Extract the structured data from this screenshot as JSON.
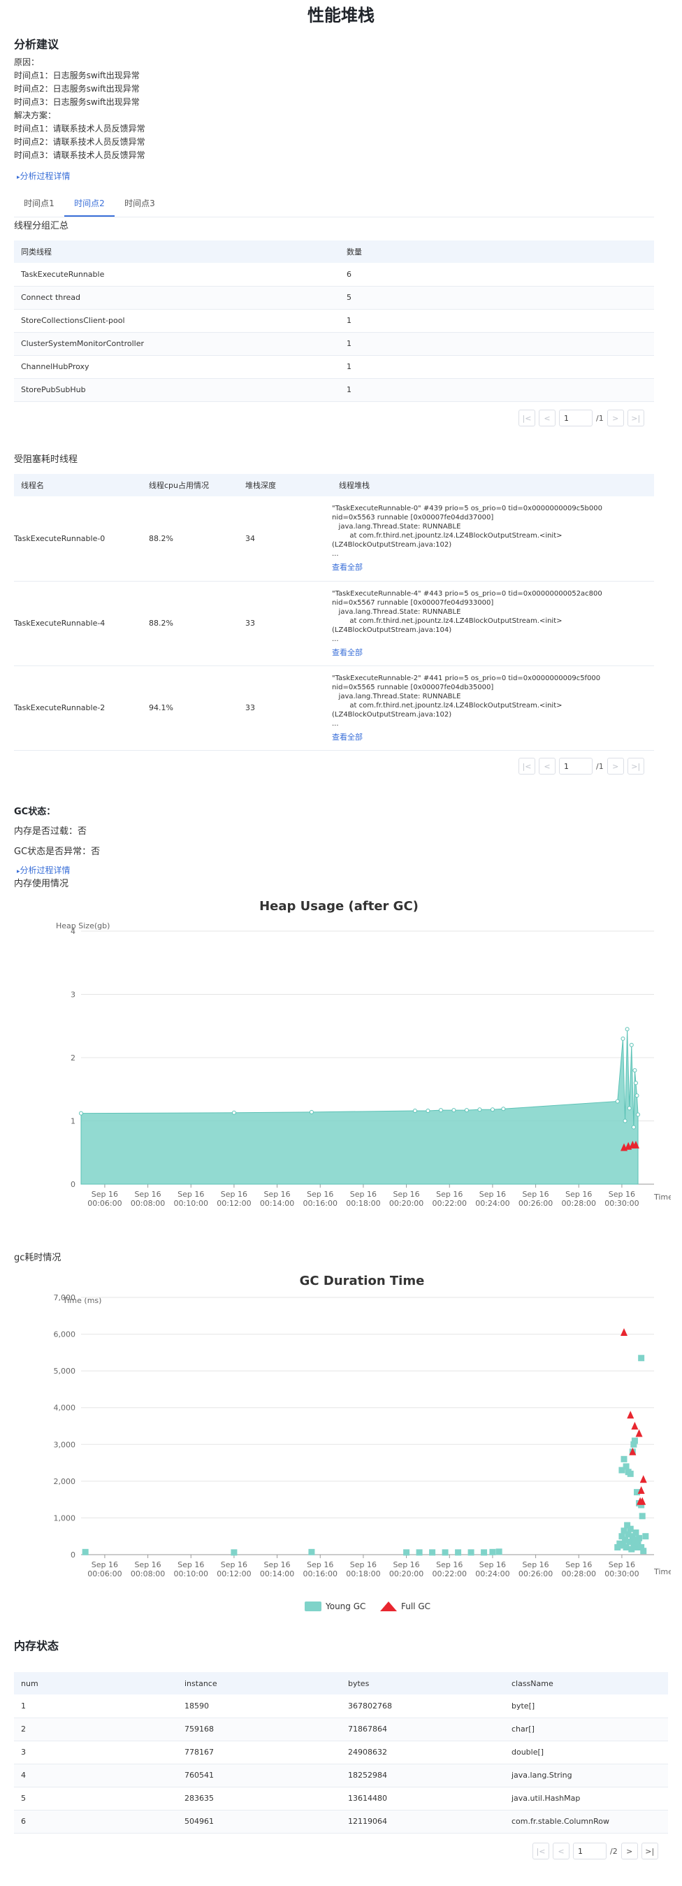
{
  "page": {
    "title": "性能堆栈"
  },
  "analysis": {
    "title": "分析建议",
    "reason_label": "原因：",
    "reasons": [
      "时间点1：日志服务swift出现异常",
      "时间点2：日志服务swift出现异常",
      "时间点3：日志服务swift出现异常"
    ],
    "solution_label": "解决方案：",
    "solutions": [
      "时间点1：请联系技术人员反馈异常",
      "时间点2：请联系技术人员反馈异常",
      "时间点3：请联系技术人员反馈异常"
    ],
    "detail_link": "分析过程详情"
  },
  "tabs": [
    {
      "label": "时间点1",
      "active": false
    },
    {
      "label": "时间点2",
      "active": true
    },
    {
      "label": "时间点3",
      "active": false
    }
  ],
  "thread_group": {
    "title": "线程分组汇总",
    "columns": [
      "同类线程",
      "数量"
    ],
    "rows": [
      [
        "TaskExecuteRunnable",
        "6"
      ],
      [
        "Connect thread",
        "5"
      ],
      [
        "StoreCollectionsClient-pool",
        "1"
      ],
      [
        "ClusterSystemMonitorController",
        "1"
      ],
      [
        "ChannelHubProxy",
        "1"
      ],
      [
        "StorePubSubHub",
        "1"
      ]
    ],
    "pagination": {
      "page": "1",
      "total": "/1"
    }
  },
  "blocked_threads": {
    "title": "受阻塞耗时线程",
    "columns": [
      "线程名",
      "线程cpu占用情况",
      "堆栈深度",
      "线程堆栈"
    ],
    "view_all": "查看全部",
    "rows": [
      {
        "name": "TaskExecuteRunnable-0",
        "cpu": "88.2%",
        "depth": "34",
        "stack": "\"TaskExecuteRunnable-0\" #439 prio=5 os_prio=0 tid=0x0000000009c5b000\nnid=0x5563 runnable [0x00007fe04dd37000]\n   java.lang.Thread.State: RUNNABLE\n        at com.fr.third.net.jpountz.lz4.LZ4BlockOutputStream.<init>\n(LZ4BlockOutputStream.java:102)\n..."
      },
      {
        "name": "TaskExecuteRunnable-4",
        "cpu": "88.2%",
        "depth": "33",
        "stack": "\"TaskExecuteRunnable-4\" #443 prio=5 os_prio=0 tid=0x00000000052ac800\nnid=0x5567 runnable [0x00007fe04d933000]\n   java.lang.Thread.State: RUNNABLE\n        at com.fr.third.net.jpountz.lz4.LZ4BlockOutputStream.<init>\n(LZ4BlockOutputStream.java:104)\n..."
      },
      {
        "name": "TaskExecuteRunnable-2",
        "cpu": "94.1%",
        "depth": "33",
        "stack": "\"TaskExecuteRunnable-2\" #441 prio=5 os_prio=0 tid=0x0000000009c5f000\nnid=0x5565 runnable [0x00007fe04db35000]\n   java.lang.Thread.State: RUNNABLE\n        at com.fr.third.net.jpountz.lz4.LZ4BlockOutputStream.<init>\n(LZ4BlockOutputStream.java:102)\n..."
      }
    ],
    "pagination": {
      "page": "1",
      "total": "/1"
    }
  },
  "gc": {
    "title": "GC状态：",
    "overload": "内存是否过载：否",
    "abnormal": "GC状态是否异常：否",
    "detail_link": "分析过程详情",
    "memory_usage_label": "内存使用情况",
    "gc_time_label": "gc耗时情况"
  },
  "chart_data": [
    {
      "type": "area",
      "title": "Heap Usage (after GC)",
      "ylabel": "Heap Size(gb)",
      "xlabel": "Time",
      "ylim": [
        0,
        4
      ],
      "yticks": [
        "0",
        "1",
        "2",
        "3",
        "4"
      ],
      "xticks": [
        {
          "t": 6,
          "l1": "Sep 16",
          "l2": "00:06:00"
        },
        {
          "t": 8,
          "l1": "Sep 16",
          "l2": "00:08:00"
        },
        {
          "t": 10,
          "l1": "Sep 16",
          "l2": "00:10:00"
        },
        {
          "t": 12,
          "l1": "Sep 16",
          "l2": "00:12:00"
        },
        {
          "t": 14,
          "l1": "Sep 16",
          "l2": "00:14:00"
        },
        {
          "t": 16,
          "l1": "Sep 16",
          "l2": "00:16:00"
        },
        {
          "t": 18,
          "l1": "Sep 16",
          "l2": "00:18:00"
        },
        {
          "t": 20,
          "l1": "Sep 16",
          "l2": "00:20:00"
        },
        {
          "t": 22,
          "l1": "Sep 16",
          "l2": "00:22:00"
        },
        {
          "t": 24,
          "l1": "Sep 16",
          "l2": "00:24:00"
        },
        {
          "t": 26,
          "l1": "Sep 16",
          "l2": "00:26:00"
        },
        {
          "t": 28,
          "l1": "Sep 16",
          "l2": "00:28:00"
        },
        {
          "t": 30,
          "l1": "Sep 16",
          "l2": "00:30:00"
        }
      ],
      "series": [
        {
          "color": "#7fd3c9",
          "points": [
            [
              4.9,
              1.12
            ],
            [
              12.0,
              1.13
            ],
            [
              15.6,
              1.14
            ],
            [
              20.4,
              1.16
            ],
            [
              21.0,
              1.16
            ],
            [
              21.6,
              1.17
            ],
            [
              22.2,
              1.17
            ],
            [
              22.8,
              1.17
            ],
            [
              23.4,
              1.18
            ],
            [
              24.0,
              1.18
            ],
            [
              24.5,
              1.19
            ],
            [
              29.8,
              1.31
            ],
            [
              30.05,
              2.3
            ],
            [
              30.15,
              1.0
            ],
            [
              30.25,
              2.45
            ],
            [
              30.35,
              1.2
            ],
            [
              30.45,
              2.2
            ],
            [
              30.55,
              0.9
            ],
            [
              30.6,
              1.8
            ],
            [
              30.65,
              1.6
            ],
            [
              30.7,
              1.4
            ],
            [
              30.75,
              1.1
            ]
          ]
        },
        {
          "color": "#e8262f",
          "marker": "triangle",
          "points": [
            [
              30.1,
              0.58
            ],
            [
              30.3,
              0.6
            ],
            [
              30.5,
              0.62
            ],
            [
              30.65,
              0.62
            ]
          ]
        }
      ]
    },
    {
      "type": "scatter",
      "title": "GC Duration Time",
      "ylabel": "Time (ms)",
      "xlabel": "Time",
      "ylim": [
        0,
        7000
      ],
      "yticks": [
        "0",
        "1,000",
        "2,000",
        "3,000",
        "4,000",
        "5,000",
        "6,000",
        "7,000"
      ],
      "xticks": [
        {
          "t": 6,
          "l1": "Sep 16",
          "l2": "00:06:00"
        },
        {
          "t": 8,
          "l1": "Sep 16",
          "l2": "00:08:00"
        },
        {
          "t": 10,
          "l1": "Sep 16",
          "l2": "00:10:00"
        },
        {
          "t": 12,
          "l1": "Sep 16",
          "l2": "00:12:00"
        },
        {
          "t": 14,
          "l1": "Sep 16",
          "l2": "00:14:00"
        },
        {
          "t": 16,
          "l1": "Sep 16",
          "l2": "00:16:00"
        },
        {
          "t": 18,
          "l1": "Sep 16",
          "l2": "00:18:00"
        },
        {
          "t": 20,
          "l1": "Sep 16",
          "l2": "00:20:00"
        },
        {
          "t": 22,
          "l1": "Sep 16",
          "l2": "00:22:00"
        },
        {
          "t": 24,
          "l1": "Sep 16",
          "l2": "00:24:00"
        },
        {
          "t": 26,
          "l1": "Sep 16",
          "l2": "00:26:00"
        },
        {
          "t": 28,
          "l1": "Sep 16",
          "l2": "00:28:00"
        },
        {
          "t": 30,
          "l1": "Sep 16",
          "l2": "00:30:00"
        }
      ],
      "legend": [
        "Young GC",
        "Full GC"
      ],
      "series": [
        {
          "name": "Young GC",
          "color": "#7fd3c9",
          "marker": "square",
          "points": [
            [
              5.1,
              70
            ],
            [
              12.0,
              60
            ],
            [
              15.6,
              70
            ],
            [
              20.0,
              60
            ],
            [
              20.6,
              60
            ],
            [
              21.2,
              60
            ],
            [
              21.8,
              60
            ],
            [
              22.4,
              60
            ],
            [
              23.0,
              60
            ],
            [
              23.6,
              60
            ],
            [
              24.0,
              70
            ],
            [
              24.3,
              80
            ],
            [
              29.8,
              200
            ],
            [
              29.9,
              300
            ],
            [
              30.0,
              500
            ],
            [
              30.05,
              250
            ],
            [
              30.1,
              650
            ],
            [
              30.15,
              400
            ],
            [
              30.2,
              200
            ],
            [
              30.25,
              800
            ],
            [
              30.3,
              550
            ],
            [
              30.35,
              350
            ],
            [
              30.4,
              700
            ],
            [
              30.45,
              150
            ],
            [
              30.5,
              500
            ],
            [
              30.55,
              250
            ],
            [
              30.6,
              400
            ],
            [
              30.65,
              600
            ],
            [
              30.7,
              200
            ],
            [
              30.75,
              300
            ],
            [
              30.8,
              450
            ],
            [
              30.9,
              200
            ],
            [
              31.0,
              100
            ],
            [
              30.0,
              2300
            ],
            [
              30.1,
              2600
            ],
            [
              30.2,
              2400
            ],
            [
              30.3,
              2250
            ],
            [
              30.4,
              2200
            ],
            [
              30.5,
              2800
            ],
            [
              30.55,
              3000
            ],
            [
              30.7,
              1700
            ],
            [
              30.6,
              3100
            ],
            [
              31.1,
              500
            ],
            [
              30.8,
              1400
            ],
            [
              30.9,
              1350
            ],
            [
              30.95,
              1050
            ],
            [
              30.9,
              5350
            ]
          ]
        },
        {
          "name": "Full GC",
          "color": "#e8262f",
          "marker": "triangle",
          "points": [
            [
              30.1,
              6050
            ],
            [
              30.4,
              3800
            ],
            [
              30.6,
              3500
            ],
            [
              30.8,
              3300
            ],
            [
              30.5,
              2800
            ],
            [
              31.0,
              2050
            ],
            [
              30.9,
              1750
            ],
            [
              30.95,
              1450
            ],
            [
              30.85,
              1450
            ]
          ]
        }
      ]
    }
  ],
  "memory_state": {
    "title": "内存状态",
    "columns": [
      "num",
      "instance",
      "bytes",
      "className"
    ],
    "rows": [
      [
        "1",
        "18590",
        "367802768",
        "byte[]"
      ],
      [
        "2",
        "759168",
        "71867864",
        "char[]"
      ],
      [
        "3",
        "778167",
        "24908632",
        "double[]"
      ],
      [
        "4",
        "760541",
        "18252984",
        "java.lang.String"
      ],
      [
        "5",
        "283635",
        "13614480",
        "java.util.HashMap"
      ],
      [
        "6",
        "504961",
        "12119064",
        "com.fr.stable.ColumnRow"
      ]
    ],
    "pagination": {
      "page": "1",
      "total": "/2"
    }
  },
  "icons": {
    "first": "first-page-icon",
    "prev": "prev-page-icon",
    "next": "next-page-icon",
    "last": "last-page-icon",
    "expand": "expand-icon"
  },
  "colors": {
    "accent": "#3a6fd8",
    "young_gc": "#7fd3c9",
    "full_gc": "#e8262f",
    "header_bg": "#f0f5fc"
  }
}
